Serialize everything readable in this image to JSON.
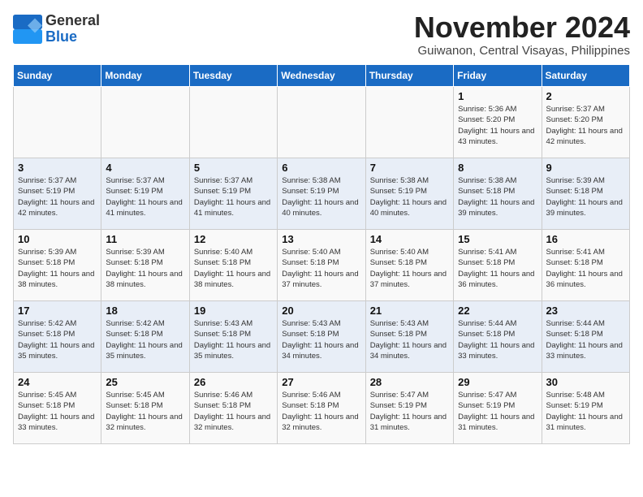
{
  "header": {
    "logo": {
      "line1": "General",
      "line2": "Blue"
    },
    "title": "November 2024",
    "subtitle": "Guiwanon, Central Visayas, Philippines"
  },
  "weekdays": [
    "Sunday",
    "Monday",
    "Tuesday",
    "Wednesday",
    "Thursday",
    "Friday",
    "Saturday"
  ],
  "weeks": [
    [
      {
        "day": "",
        "info": ""
      },
      {
        "day": "",
        "info": ""
      },
      {
        "day": "",
        "info": ""
      },
      {
        "day": "",
        "info": ""
      },
      {
        "day": "",
        "info": ""
      },
      {
        "day": "1",
        "info": "Sunrise: 5:36 AM\nSunset: 5:20 PM\nDaylight: 11 hours and 43 minutes."
      },
      {
        "day": "2",
        "info": "Sunrise: 5:37 AM\nSunset: 5:20 PM\nDaylight: 11 hours and 42 minutes."
      }
    ],
    [
      {
        "day": "3",
        "info": "Sunrise: 5:37 AM\nSunset: 5:19 PM\nDaylight: 11 hours and 42 minutes."
      },
      {
        "day": "4",
        "info": "Sunrise: 5:37 AM\nSunset: 5:19 PM\nDaylight: 11 hours and 41 minutes."
      },
      {
        "day": "5",
        "info": "Sunrise: 5:37 AM\nSunset: 5:19 PM\nDaylight: 11 hours and 41 minutes."
      },
      {
        "day": "6",
        "info": "Sunrise: 5:38 AM\nSunset: 5:19 PM\nDaylight: 11 hours and 40 minutes."
      },
      {
        "day": "7",
        "info": "Sunrise: 5:38 AM\nSunset: 5:19 PM\nDaylight: 11 hours and 40 minutes."
      },
      {
        "day": "8",
        "info": "Sunrise: 5:38 AM\nSunset: 5:18 PM\nDaylight: 11 hours and 39 minutes."
      },
      {
        "day": "9",
        "info": "Sunrise: 5:39 AM\nSunset: 5:18 PM\nDaylight: 11 hours and 39 minutes."
      }
    ],
    [
      {
        "day": "10",
        "info": "Sunrise: 5:39 AM\nSunset: 5:18 PM\nDaylight: 11 hours and 38 minutes."
      },
      {
        "day": "11",
        "info": "Sunrise: 5:39 AM\nSunset: 5:18 PM\nDaylight: 11 hours and 38 minutes."
      },
      {
        "day": "12",
        "info": "Sunrise: 5:40 AM\nSunset: 5:18 PM\nDaylight: 11 hours and 38 minutes."
      },
      {
        "day": "13",
        "info": "Sunrise: 5:40 AM\nSunset: 5:18 PM\nDaylight: 11 hours and 37 minutes."
      },
      {
        "day": "14",
        "info": "Sunrise: 5:40 AM\nSunset: 5:18 PM\nDaylight: 11 hours and 37 minutes."
      },
      {
        "day": "15",
        "info": "Sunrise: 5:41 AM\nSunset: 5:18 PM\nDaylight: 11 hours and 36 minutes."
      },
      {
        "day": "16",
        "info": "Sunrise: 5:41 AM\nSunset: 5:18 PM\nDaylight: 11 hours and 36 minutes."
      }
    ],
    [
      {
        "day": "17",
        "info": "Sunrise: 5:42 AM\nSunset: 5:18 PM\nDaylight: 11 hours and 35 minutes."
      },
      {
        "day": "18",
        "info": "Sunrise: 5:42 AM\nSunset: 5:18 PM\nDaylight: 11 hours and 35 minutes."
      },
      {
        "day": "19",
        "info": "Sunrise: 5:43 AM\nSunset: 5:18 PM\nDaylight: 11 hours and 35 minutes."
      },
      {
        "day": "20",
        "info": "Sunrise: 5:43 AM\nSunset: 5:18 PM\nDaylight: 11 hours and 34 minutes."
      },
      {
        "day": "21",
        "info": "Sunrise: 5:43 AM\nSunset: 5:18 PM\nDaylight: 11 hours and 34 minutes."
      },
      {
        "day": "22",
        "info": "Sunrise: 5:44 AM\nSunset: 5:18 PM\nDaylight: 11 hours and 33 minutes."
      },
      {
        "day": "23",
        "info": "Sunrise: 5:44 AM\nSunset: 5:18 PM\nDaylight: 11 hours and 33 minutes."
      }
    ],
    [
      {
        "day": "24",
        "info": "Sunrise: 5:45 AM\nSunset: 5:18 PM\nDaylight: 11 hours and 33 minutes."
      },
      {
        "day": "25",
        "info": "Sunrise: 5:45 AM\nSunset: 5:18 PM\nDaylight: 11 hours and 32 minutes."
      },
      {
        "day": "26",
        "info": "Sunrise: 5:46 AM\nSunset: 5:18 PM\nDaylight: 11 hours and 32 minutes."
      },
      {
        "day": "27",
        "info": "Sunrise: 5:46 AM\nSunset: 5:18 PM\nDaylight: 11 hours and 32 minutes."
      },
      {
        "day": "28",
        "info": "Sunrise: 5:47 AM\nSunset: 5:19 PM\nDaylight: 11 hours and 31 minutes."
      },
      {
        "day": "29",
        "info": "Sunrise: 5:47 AM\nSunset: 5:19 PM\nDaylight: 11 hours and 31 minutes."
      },
      {
        "day": "30",
        "info": "Sunrise: 5:48 AM\nSunset: 5:19 PM\nDaylight: 11 hours and 31 minutes."
      }
    ]
  ]
}
